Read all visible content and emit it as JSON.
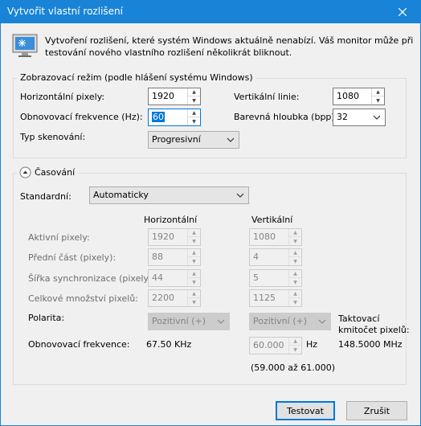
{
  "window": {
    "title": "Vytvořit vlastní rozlišení"
  },
  "info": {
    "line1": "Vytvoření rozlišení, které systém Windows aktuálně nenabízí. Váš monitor může při",
    "line2": "testování nového vlastního rozlišení několikrát bliknout."
  },
  "display_mode": {
    "group_title": "Zobrazovací režim (podle hlášení systému Windows)",
    "horizontal_label": "Horizontální pixely:",
    "horizontal_value": "1920",
    "vertical_label": "Vertikální linie:",
    "vertical_value": "1080",
    "refresh_label": "Obnovovací frekvence (Hz):",
    "refresh_value": "60",
    "color_depth_label": "Barevná hloubka (bpp):",
    "color_depth_value": "32",
    "scan_label": "Typ skenování:",
    "scan_value": "Progresivní"
  },
  "timing": {
    "group_title": "Časování",
    "standard_label": "Standardní:",
    "standard_value": "Automaticky",
    "col_horizontal": "Horizontální",
    "col_vertical": "Vertikální",
    "rows": [
      {
        "label": "Aktivní pixely:",
        "h": "1920",
        "v": "1080"
      },
      {
        "label": "Přední část (pixely):",
        "h": "88",
        "v": "4"
      },
      {
        "label": "Šířka synchronizace (pixely):",
        "h": "44",
        "v": "5"
      },
      {
        "label": "Celkové množství pixelů:",
        "h": "2200",
        "v": "1125"
      }
    ],
    "polarity_label": "Polarita:",
    "polarity_h": "Pozitivní (+)",
    "polarity_v": "Pozitivní (+)",
    "pixel_clock_label_1": "Taktovací",
    "pixel_clock_label_2": "kmitočet pixelů:",
    "pixel_clock_value": "148.5000 MHz",
    "refresh_label": "Obnovovací frekvence:",
    "h_refresh": "67.50 KHz",
    "v_refresh": "60.000",
    "v_refresh_unit": "Hz",
    "v_refresh_range": "(59.000 až 61.000)"
  },
  "buttons": {
    "test": "Testovat",
    "cancel": "Zrušit"
  },
  "colors": {
    "titlebar": "#1883d7",
    "accent": "#0078d7"
  },
  "icons": {
    "monitor": "monitor-icon",
    "close": "close-icon",
    "collapse": "collapse-up-icon"
  }
}
